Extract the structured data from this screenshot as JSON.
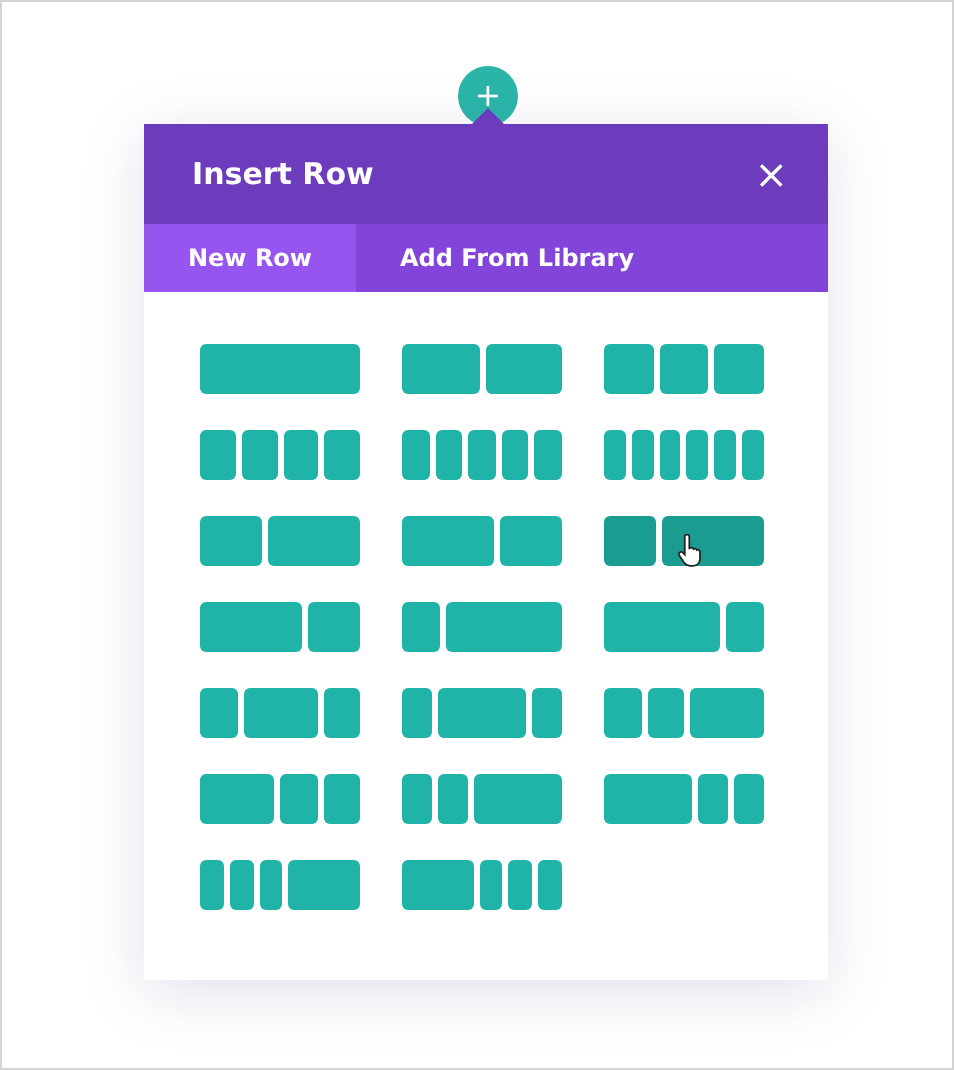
{
  "add_button": {
    "label": "+"
  },
  "dialog": {
    "title": "Insert Row",
    "close": "×"
  },
  "tabs": [
    {
      "label": "New Row",
      "selected": true
    },
    {
      "label": "Add From Library",
      "selected": false
    }
  ],
  "layouts": [
    {
      "hovered": false,
      "columns": [
        {
          "kind": "full"
        }
      ]
    },
    {
      "hovered": false,
      "columns": [
        {
          "kind": "half"
        },
        {
          "kind": "half"
        }
      ]
    },
    {
      "hovered": false,
      "columns": [
        {
          "kind": "third"
        },
        {
          "kind": "third"
        },
        {
          "kind": "third"
        }
      ]
    },
    {
      "hovered": false,
      "columns": [
        {
          "kind": "quarter"
        },
        {
          "kind": "quarter"
        },
        {
          "kind": "quarter"
        },
        {
          "kind": "quarter"
        }
      ]
    },
    {
      "hovered": false,
      "columns": [
        {
          "kind": "fifth"
        },
        {
          "kind": "fifth"
        },
        {
          "kind": "fifth"
        },
        {
          "kind": "fifth"
        },
        {
          "kind": "fifth"
        }
      ]
    },
    {
      "hovered": false,
      "columns": [
        {
          "kind": "sixth"
        },
        {
          "kind": "sixth"
        },
        {
          "kind": "sixth"
        },
        {
          "kind": "sixth"
        },
        {
          "kind": "sixth"
        },
        {
          "kind": "sixth"
        }
      ]
    },
    {
      "hovered": false,
      "columns": [
        {
          "kind": "two-fifths"
        },
        {
          "kind": "three-fifths"
        }
      ]
    },
    {
      "hovered": false,
      "columns": [
        {
          "kind": "three-fifths"
        },
        {
          "kind": "two-fifths"
        }
      ]
    },
    {
      "hovered": true,
      "columns": [
        {
          "kind": "third"
        },
        {
          "kind": "two-thirds"
        }
      ]
    },
    {
      "hovered": false,
      "columns": [
        {
          "kind": "two-thirds"
        },
        {
          "kind": "third"
        }
      ]
    },
    {
      "hovered": false,
      "columns": [
        {
          "kind": "quarter"
        },
        {
          "kind": "three-quarters"
        }
      ]
    },
    {
      "hovered": false,
      "columns": [
        {
          "kind": "three-quarters"
        },
        {
          "kind": "quarter"
        }
      ]
    },
    {
      "hovered": false,
      "columns": [
        {
          "kind": "quarter"
        },
        {
          "kind": "half"
        },
        {
          "kind": "quarter"
        }
      ]
    },
    {
      "hovered": false,
      "columns": [
        {
          "kind": "fifth"
        },
        {
          "kind": "three-fifths"
        },
        {
          "kind": "fifth"
        }
      ]
    },
    {
      "hovered": false,
      "columns": [
        {
          "kind": "quarter"
        },
        {
          "kind": "quarter"
        },
        {
          "kind": "half"
        }
      ]
    },
    {
      "hovered": false,
      "columns": [
        {
          "kind": "half"
        },
        {
          "kind": "quarter"
        },
        {
          "kind": "quarter"
        }
      ]
    },
    {
      "hovered": false,
      "columns": [
        {
          "kind": "fifth"
        },
        {
          "kind": "fifth"
        },
        {
          "kind": "three-fifths"
        }
      ]
    },
    {
      "hovered": false,
      "columns": [
        {
          "kind": "three-fifths"
        },
        {
          "kind": "fifth"
        },
        {
          "kind": "fifth"
        }
      ]
    },
    {
      "hovered": false,
      "columns": [
        {
          "kind": "sixth"
        },
        {
          "kind": "sixth"
        },
        {
          "kind": "sixth"
        },
        {
          "kind": "half"
        }
      ]
    },
    {
      "hovered": false,
      "columns": [
        {
          "kind": "half"
        },
        {
          "kind": "sixth"
        },
        {
          "kind": "sixth"
        },
        {
          "kind": "sixth"
        }
      ]
    }
  ]
}
